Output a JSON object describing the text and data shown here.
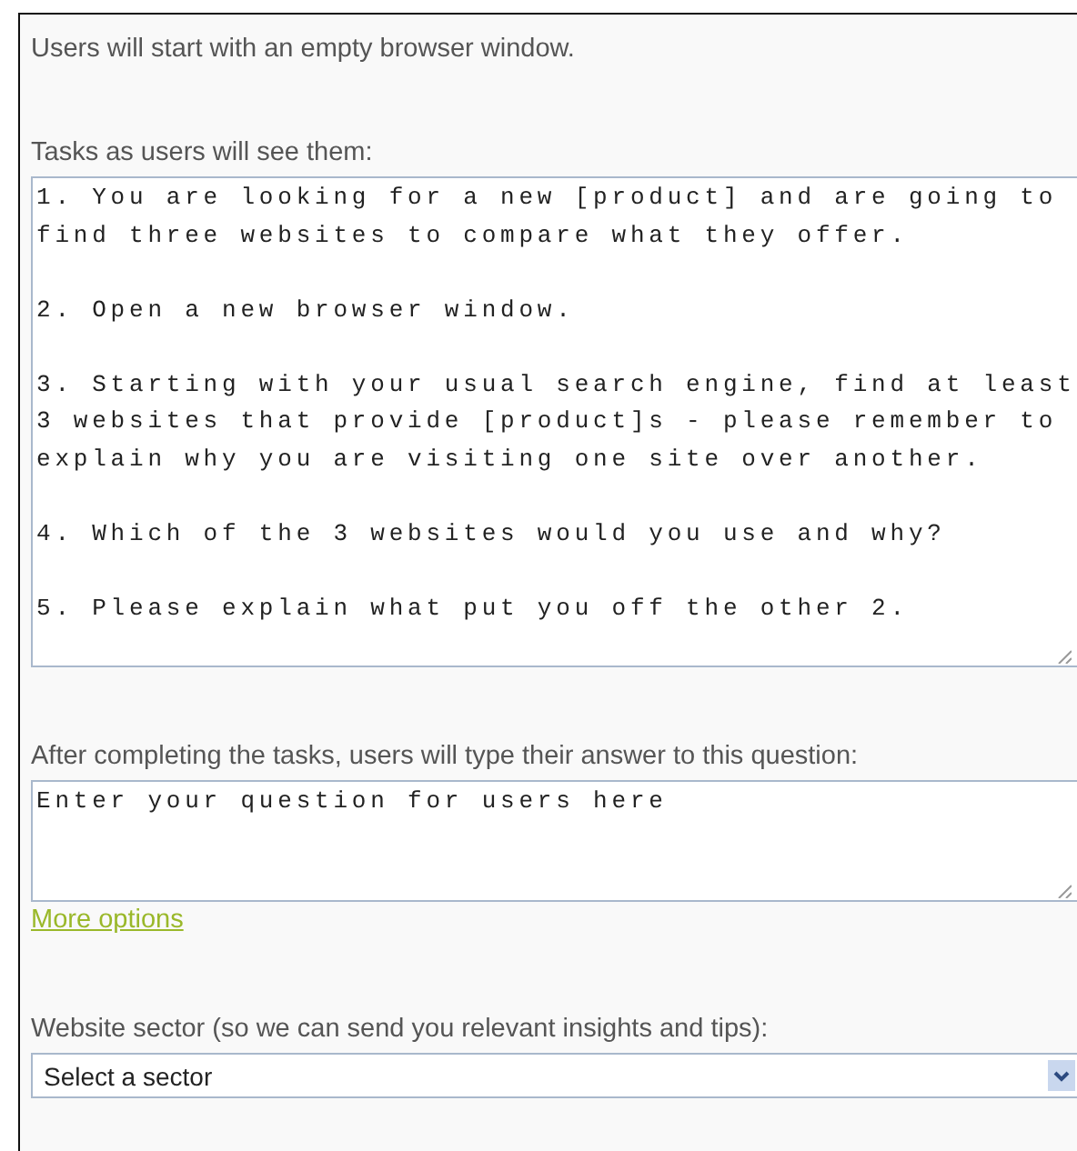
{
  "intro": "Users will start with an empty browser window.",
  "tasks": {
    "label": "Tasks as users will see them:",
    "value": "1. You are looking for a new [product] and are going to\nfind three websites to compare what they offer.\n\n2. Open a new browser window.\n\n3. Starting with your usual search engine, find at least\n3 websites that provide [product]s - please remember to\nexplain why you are visiting one site over another.\n\n4. Which of the 3 websites would you use and why?\n\n5. Please explain what put you off the other 2."
  },
  "question": {
    "label": "After completing the tasks, users will type their answer to this question:",
    "value": "Enter your question for users here"
  },
  "more_options": "More options",
  "sector": {
    "label": "Website sector (so we can send you relevant insights and tips):",
    "value": "Select a sector"
  }
}
